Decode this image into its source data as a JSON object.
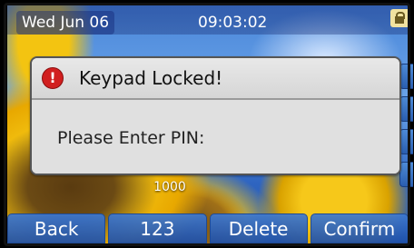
{
  "status_bar": {
    "date": "Wed Jun 06",
    "time": "09:03:02",
    "lock_icon": "lock-icon"
  },
  "dialog": {
    "title": "Keypad Locked!",
    "alert_icon": "alert-icon",
    "alert_glyph": "!",
    "prompt": "Please Enter PIN:",
    "pin_value": ""
  },
  "input_hint": "1000",
  "softkeys": [
    {
      "label": "Back"
    },
    {
      "label": "123"
    },
    {
      "label": "Delete"
    },
    {
      "label": "Confirm"
    }
  ],
  "colors": {
    "softkey": "#3c78d2",
    "dialog_bg": "#dcdcdc",
    "alert": "#d11f1f"
  }
}
